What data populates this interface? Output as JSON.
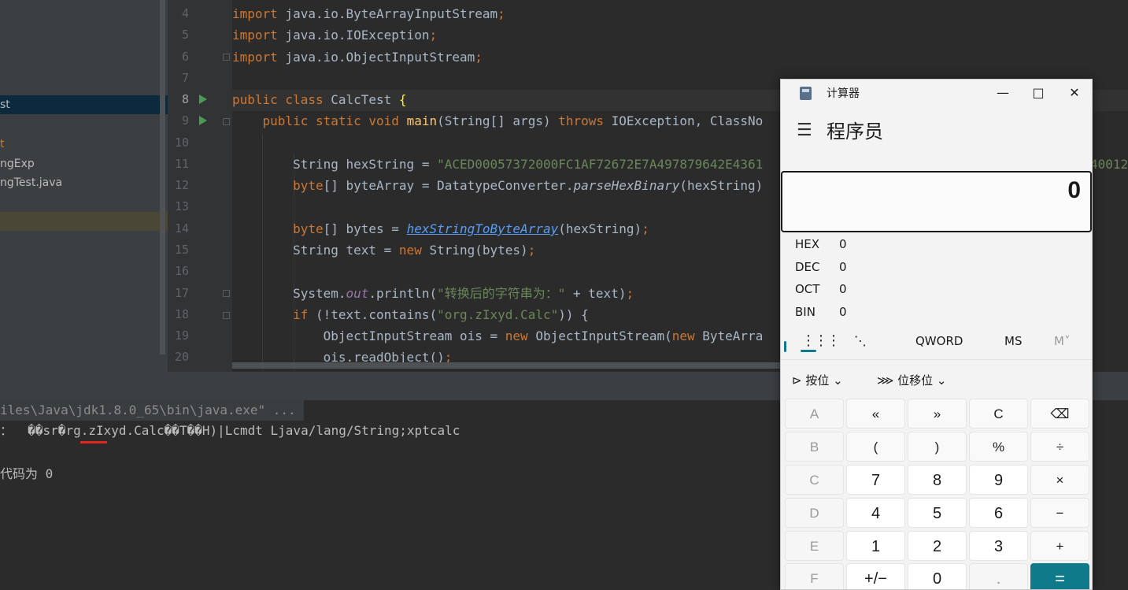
{
  "project_panel": {
    "items": [
      {
        "label": "st"
      },
      {
        "label": "t"
      },
      {
        "label": "ngExp"
      },
      {
        "label": "ngTest.java"
      }
    ]
  },
  "editor": {
    "line_numbers": [
      "4",
      "5",
      "6",
      "7",
      "8",
      "9",
      "10",
      "11",
      "12",
      "13",
      "14",
      "15",
      "16",
      "17",
      "18",
      "19",
      "20"
    ],
    "lines": {
      "l4": [
        "import",
        " java.io.ByteArrayInputStream",
        ";"
      ],
      "l5": [
        "import",
        " java.io.IOException",
        ";"
      ],
      "l6": [
        "import",
        " java.io.ObjectInputStream",
        ";"
      ],
      "l8": [
        "public class",
        " CalcTest ",
        "{"
      ],
      "l9": [
        "    public static void ",
        "main",
        "(String[] args) ",
        "throws",
        " IOException, ClassNo"
      ],
      "l11": [
        "        String hexString = ",
        "\"ACED00057372000FC1AF72672E7A497879642E4361"
      ],
      "l11_tail": "40012",
      "l12": [
        "        ",
        "byte",
        "[] byteArray = DatatypeConverter.",
        "parseHexBinary",
        "(hexString)"
      ],
      "l14": [
        "        ",
        "byte",
        "[] bytes = ",
        "hexStringToByteArray",
        "(hexString)",
        ";"
      ],
      "l15": [
        "        String text = ",
        "new",
        " String(bytes)",
        ";"
      ],
      "l17": [
        "        System.",
        "out",
        ".println(",
        "\"转换后的字符串为：\"",
        " + text)",
        ";"
      ],
      "l18": [
        "        ",
        "if",
        " (!text.contains(",
        "\"org.zIxyd.Calc\"",
        ")) {"
      ],
      "l19": [
        "            ObjectInputStream ois = ",
        "new",
        " ObjectInputStream(",
        "new",
        " ByteArra"
      ],
      "l20": [
        "            ois.readObject()",
        ";"
      ]
    }
  },
  "console": {
    "command": "iles\\Java\\jdk1.8.0_65\\bin\\java.exe\" ...",
    "output_prefix": "：  ",
    "output": "��sr�rg.zIxyd.Calc��T��H)|Lcmdt Ljava/lang/String;xptcalc",
    "exit": "代码为 0"
  },
  "calculator": {
    "title": "计算器",
    "mode": "程序员",
    "display": "0",
    "radix": [
      {
        "label": "HEX",
        "value": "0"
      },
      {
        "label": "DEC",
        "value": "0"
      },
      {
        "label": "OCT",
        "value": "0"
      },
      {
        "label": "BIN",
        "value": "0"
      }
    ],
    "tools": {
      "word_size": "QWORD",
      "ms": "MS",
      "m_dropdown": "M˅"
    },
    "bitwise": "按位",
    "bitshift": "位移位",
    "keys": [
      [
        "A",
        "«",
        "»",
        "C",
        "⌫"
      ],
      [
        "B",
        "(",
        ")",
        "%",
        "÷"
      ],
      [
        "C",
        "7",
        "8",
        "9",
        "×"
      ],
      [
        "D",
        "4",
        "5",
        "6",
        "−"
      ],
      [
        "E",
        "1",
        "2",
        "3",
        "+"
      ],
      [
        "F",
        "+/−",
        "0",
        ".",
        "="
      ]
    ]
  }
}
